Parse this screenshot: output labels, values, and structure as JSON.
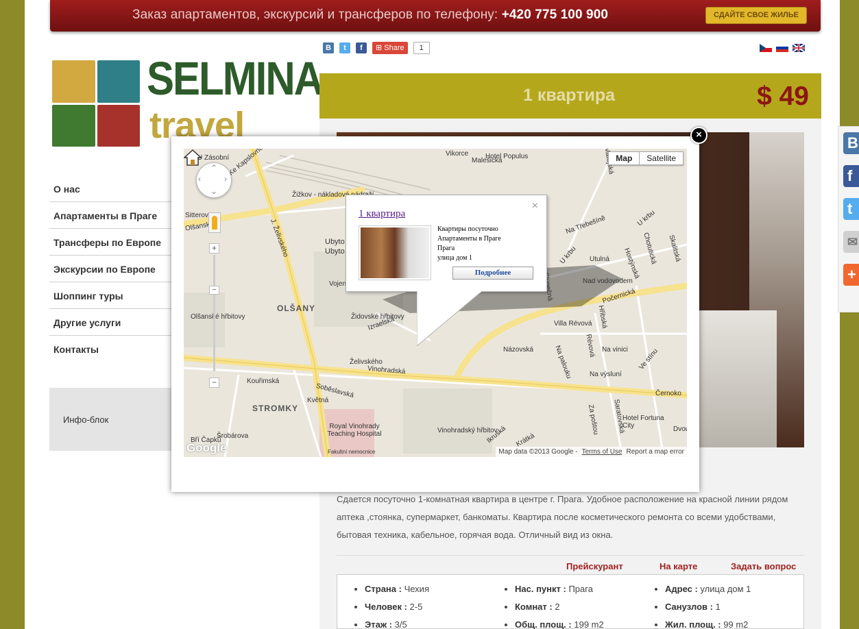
{
  "banner": {
    "text_prefix": "Заказ апартаментов, экскурсий и трансферов по телефону:",
    "phone": "+420 775 100 900",
    "cta_label": "СДАЙТЕ СВОЕ ЖИЛЬЕ"
  },
  "social": {
    "icons": [
      "vkontakte-icon",
      "twitter-icon",
      "facebook-icon"
    ],
    "share_label": "Share",
    "share_count": "1"
  },
  "flags": [
    "czech-flag",
    "russian-flag",
    "english-flag"
  ],
  "logo": {
    "word1": "SELMINA",
    "word2": "travel"
  },
  "menu": {
    "items": [
      {
        "label": "О нас"
      },
      {
        "label": "Апартаменты в Праге"
      },
      {
        "label": "Трансферы по Европе"
      },
      {
        "label": "Экскурсии по Европе"
      },
      {
        "label": "Шоппинг туры"
      },
      {
        "label": "Другие услуги"
      },
      {
        "label": "Контакты"
      }
    ]
  },
  "info_block": {
    "label": "Инфо-блок"
  },
  "listing": {
    "title": "1 квартира",
    "price": "$ 49",
    "description": "Сдается посуточно 1-комнатная квартира в центре г. Прага. Удобное расположение на красной линии рядом аптека ,стоянка, супермаркет, банкоматы. Квартира после косметического ремонта со всеми удобствами, бытовая техника, кабельное, горячая вода. Отличный вид из окна.",
    "tabs": [
      "Прейскурант",
      "На карте",
      "Задать вопрос"
    ],
    "properties": [
      [
        {
          "k": "Страна :",
          "v": "Чехия"
        },
        {
          "k": "Человек :",
          "v": "2-5"
        },
        {
          "k": "Этаж :",
          "v": "3/5"
        }
      ],
      [
        {
          "k": "Нас. пункт :",
          "v": "Прага"
        },
        {
          "k": "Комнат :",
          "v": "2"
        },
        {
          "k": "Общ. площ. :",
          "v": "199 m2"
        }
      ],
      [
        {
          "k": "Адрес :",
          "v": "улица дом 1"
        },
        {
          "k": "Санузлов :",
          "v": "1"
        },
        {
          "k": "Жил. площ. :",
          "v": "99 m2"
        }
      ]
    ]
  },
  "right_social": {
    "buttons": [
      {
        "icon": "vkontakte-icon",
        "glyph": "B",
        "color": "#4a76a8"
      },
      {
        "icon": "facebook-icon",
        "glyph": "f",
        "color": "#3b5998"
      },
      {
        "icon": "twitter-icon",
        "glyph": "t",
        "color": "#55acee"
      },
      {
        "icon": "mail-icon",
        "glyph": "✉",
        "color": "#d0d0d0"
      },
      {
        "icon": "more-icon",
        "glyph": "+",
        "color": "#f0672f"
      }
    ]
  },
  "map": {
    "type_buttons": [
      "Map",
      "Satellite"
    ],
    "active_type": "Map",
    "labels": [
      "Vikorce",
      "Hotel Populus",
      "Žižkov - nákladové nádraží",
      "Ke Kapslovně",
      "Olšanská",
      "J. Želivského",
      "OLŠANY",
      "Olšanské hřbitovy",
      "Vojenský pohřebiště",
      "Židovské hřbitovy",
      "Izraelská",
      "Želivského",
      "Vinohradská",
      "Kouřimská",
      "Soběslavská",
      "Květná",
      "STROMKY",
      "Šrobárova",
      "Bří Čapků",
      "Royal Vinohrady Teaching Hospital",
      "Fakultní nemocnice",
      "Vinohradský hřbitov",
      "Počernická",
      "Villa Révová",
      "Názovská",
      "Révová",
      "Na palouku",
      "Na vinici",
      "Na výsluní",
      "Ve stínu",
      "Za poštou",
      "Saratovská",
      "Hotel Fortuna City",
      "Dvou",
      "Černoko",
      "Na Třebešíně",
      "U krbu",
      "Utulná",
      "Hostýnská",
      "Chotutická",
      "Skalitská",
      "Nad vodovodem",
      "Slunečná",
      "U krbu",
      "Hřibská",
      "Ikruská",
      "Krátká",
      "Matějská",
      "Malešická",
      "Ubyto",
      "Sitterova",
      "U Zásobní",
      "Ubyto Al"
    ],
    "footer": {
      "data": "Map data ©2013 Google -",
      "terms": "Terms of Use",
      "report": "Report a map error"
    },
    "google_logo": "Google",
    "info_window": {
      "title": "1 квартира",
      "lines": [
        "Квартиры посуточно",
        "Апартаменты в Праге",
        "Прага",
        "улица дом 1"
      ],
      "button": "Подробнее",
      "close": "×"
    }
  },
  "modal": {
    "close": "×"
  }
}
